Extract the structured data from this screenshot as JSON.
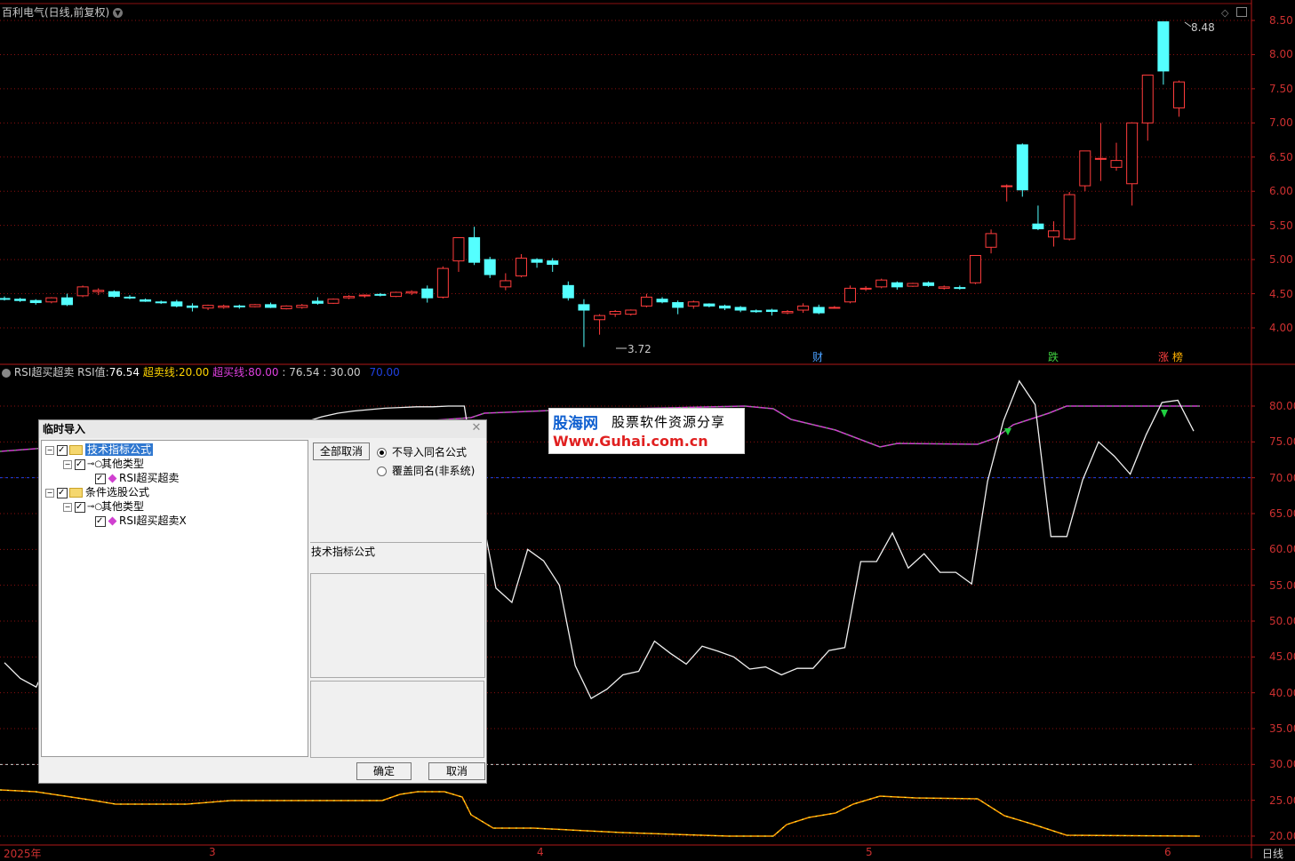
{
  "main_chart": {
    "title": "百利电气(日线,前复权)",
    "y_ticks": [
      "8.50",
      "8.00",
      "7.50",
      "7.00",
      "6.50",
      "6.00",
      "5.50",
      "5.00",
      "4.50",
      "4.00"
    ],
    "high_label": "8.48",
    "low_label": "3.72",
    "events": [
      {
        "text": "财",
        "color": "#4aa0ff"
      },
      {
        "text": "跌",
        "color": "#40d040"
      },
      {
        "text": "涨",
        "color": "#ff4040"
      },
      {
        "text": "榜",
        "color": "#ffb000"
      }
    ],
    "colors": {
      "up": "#ff3c3c",
      "down": "#54ffff",
      "grid": "#8c1010"
    }
  },
  "rsi_panel": {
    "name": "RSI超买超卖",
    "rsi_label": "RSI值:",
    "rsi_value": "76.54",
    "oversold_label": "超卖线:",
    "oversold_value": "20.00",
    "overbought_label": "超买线:",
    "overbought_value": "80.00",
    "extra1": ": 76.54",
    "extra2": ": 30.00",
    "extra3": "70.00",
    "y_ticks": [
      "80.00",
      "75.00",
      "70.00",
      "65.00",
      "60.00",
      "55.00",
      "50.00",
      "45.00",
      "40.00",
      "35.00",
      "30.00",
      "25.00",
      "20.00"
    ]
  },
  "x_axis": {
    "labels": [
      "2025年",
      "3",
      "4",
      "5",
      "6"
    ],
    "period": "日线"
  },
  "watermark": {
    "line1_a": "股海网",
    "line1_b": "股票软件资源分享",
    "line2": "Www.Guhai.com.cn"
  },
  "dialog": {
    "title": "临时导入",
    "tree": [
      {
        "label": "技术指标公式",
        "level": 0,
        "type": "folder",
        "selected": true
      },
      {
        "label": "其他类型",
        "level": 1,
        "type": "key"
      },
      {
        "label": "RSI超买超卖",
        "level": 2,
        "type": "formula"
      },
      {
        "label": "条件选股公式",
        "level": 0,
        "type": "folder"
      },
      {
        "label": "其他类型",
        "level": 1,
        "type": "key"
      },
      {
        "label": "RSI超买超卖X",
        "level": 2,
        "type": "formula"
      }
    ],
    "deselect_all": "全部取消",
    "radio_no_import": "不导入同名公式",
    "radio_overwrite": "覆盖同名(非系统)",
    "info_label": "技术指标公式",
    "ok": "确定",
    "cancel": "取消"
  },
  "chart_data": {
    "type": "candlestick",
    "title": "百利电气(日线,前复权)",
    "ylim": [
      3.6,
      8.6
    ],
    "candles": [
      [
        4.43,
        4.46,
        4.4,
        4.42
      ],
      [
        4.42,
        4.44,
        4.38,
        4.4
      ],
      [
        4.4,
        4.42,
        4.34,
        4.37
      ],
      [
        4.38,
        4.45,
        4.36,
        4.44
      ],
      [
        4.44,
        4.5,
        4.32,
        4.34
      ],
      [
        4.47,
        4.62,
        4.45,
        4.6
      ],
      [
        4.53,
        4.58,
        4.48,
        4.55
      ],
      [
        4.53,
        4.55,
        4.44,
        4.46
      ],
      [
        4.45,
        4.48,
        4.42,
        4.44
      ],
      [
        4.41,
        4.43,
        4.38,
        4.39
      ],
      [
        4.38,
        4.4,
        4.35,
        4.37
      ],
      [
        4.38,
        4.41,
        4.3,
        4.32
      ],
      [
        4.32,
        4.36,
        4.24,
        4.3
      ],
      [
        4.29,
        4.34,
        4.26,
        4.33
      ],
      [
        4.3,
        4.34,
        4.28,
        4.32
      ],
      [
        4.32,
        4.34,
        4.28,
        4.31
      ],
      [
        4.31,
        4.35,
        4.3,
        4.34
      ],
      [
        4.34,
        4.37,
        4.29,
        4.3
      ],
      [
        4.28,
        4.33,
        4.27,
        4.32
      ],
      [
        4.3,
        4.35,
        4.28,
        4.33
      ],
      [
        4.39,
        4.45,
        4.34,
        4.36
      ],
      [
        4.36,
        4.43,
        4.35,
        4.42
      ],
      [
        4.44,
        4.48,
        4.42,
        4.46
      ],
      [
        4.47,
        4.49,
        4.44,
        4.48
      ],
      [
        4.49,
        4.51,
        4.46,
        4.48
      ],
      [
        4.46,
        4.53,
        4.45,
        4.52
      ],
      [
        4.51,
        4.55,
        4.48,
        4.53
      ],
      [
        4.57,
        4.62,
        4.37,
        4.44
      ],
      [
        4.45,
        4.9,
        4.43,
        4.87
      ],
      [
        4.98,
        5.32,
        4.82,
        5.32
      ],
      [
        5.32,
        5.48,
        4.92,
        4.96
      ],
      [
        5.0,
        5.04,
        4.73,
        4.78
      ],
      [
        4.6,
        4.8,
        4.55,
        4.69
      ],
      [
        4.76,
        5.08,
        4.74,
        5.02
      ],
      [
        5.0,
        5.02,
        4.88,
        4.96
      ],
      [
        4.98,
        5.02,
        4.82,
        4.93
      ],
      [
        4.62,
        4.68,
        4.4,
        4.44
      ],
      [
        4.34,
        4.42,
        3.72,
        4.26
      ],
      [
        4.12,
        4.2,
        3.9,
        4.18
      ],
      [
        4.2,
        4.26,
        4.16,
        4.24
      ],
      [
        4.2,
        4.27,
        4.18,
        4.26
      ],
      [
        4.32,
        4.5,
        4.3,
        4.45
      ],
      [
        4.42,
        4.45,
        4.36,
        4.38
      ],
      [
        4.37,
        4.4,
        4.2,
        4.3
      ],
      [
        4.32,
        4.4,
        4.28,
        4.38
      ],
      [
        4.35,
        4.36,
        4.3,
        4.32
      ],
      [
        4.32,
        4.34,
        4.26,
        4.29
      ],
      [
        4.3,
        4.32,
        4.23,
        4.26
      ],
      [
        4.25,
        4.27,
        4.22,
        4.24
      ],
      [
        4.26,
        4.28,
        4.18,
        4.24
      ],
      [
        4.22,
        4.26,
        4.2,
        4.24
      ],
      [
        4.26,
        4.36,
        4.22,
        4.32
      ],
      [
        4.3,
        4.34,
        4.2,
        4.22
      ],
      [
        4.29,
        4.32,
        4.28,
        4.3
      ],
      [
        4.38,
        4.62,
        4.36,
        4.58
      ],
      [
        4.57,
        4.61,
        4.54,
        4.58
      ],
      [
        4.6,
        4.72,
        4.58,
        4.7
      ],
      [
        4.66,
        4.68,
        4.56,
        4.6
      ],
      [
        4.61,
        4.66,
        4.6,
        4.65
      ],
      [
        4.66,
        4.68,
        4.6,
        4.62
      ],
      [
        4.58,
        4.62,
        4.56,
        4.6
      ],
      [
        4.59,
        4.62,
        4.56,
        4.58
      ],
      [
        4.66,
        5.06,
        4.64,
        5.06
      ],
      [
        5.18,
        5.44,
        5.09,
        5.38
      ],
      [
        6.08,
        6.1,
        5.85,
        6.08
      ],
      [
        6.68,
        6.7,
        5.92,
        6.02
      ],
      [
        5.52,
        5.79,
        5.43,
        5.45
      ],
      [
        5.33,
        5.56,
        5.19,
        5.42
      ],
      [
        5.3,
        5.99,
        5.28,
        5.95
      ],
      [
        6.08,
        6.59,
        6.0,
        6.59
      ],
      [
        6.48,
        7.0,
        6.15,
        6.48
      ],
      [
        6.35,
        6.71,
        6.3,
        6.45
      ],
      [
        6.11,
        7.01,
        5.79,
        7.0
      ],
      [
        7.0,
        7.7,
        6.74,
        7.7
      ],
      [
        8.48,
        8.48,
        7.56,
        7.76
      ],
      [
        7.22,
        7.62,
        7.09,
        7.6
      ]
    ],
    "rsi": [
      44.2,
      42.0,
      40.8,
      45.5,
      50.2,
      53.0,
      55.0,
      57.5,
      60.0,
      62.0,
      64.0,
      66.5,
      68.0,
      70.0,
      72.0,
      73.5,
      74.8,
      76.0,
      77.0,
      77.8,
      78.5,
      79.0,
      79.3,
      79.5,
      79.7,
      79.8,
      79.9,
      79.9,
      80.0,
      80.0,
      66.0,
      54.6,
      52.6,
      60.0,
      58.4,
      55.0,
      43.8,
      39.2,
      40.5,
      42.5,
      43.0,
      47.2,
      45.5,
      44.0,
      46.5,
      45.8,
      45.0,
      43.3,
      43.6,
      42.5,
      43.4,
      43.4,
      45.9,
      46.3,
      58.3,
      58.3,
      62.3,
      57.4,
      59.4,
      56.8,
      56.8,
      55.2,
      69.5,
      77.9,
      83.5,
      80.2,
      61.8,
      61.8,
      69.7,
      75.0,
      73.0,
      70.5,
      76.0,
      80.5,
      80.8,
      76.5
    ],
    "overbought_line": 80,
    "oversold_line": 20,
    "mid_line": 70,
    "low_line": 30
  }
}
